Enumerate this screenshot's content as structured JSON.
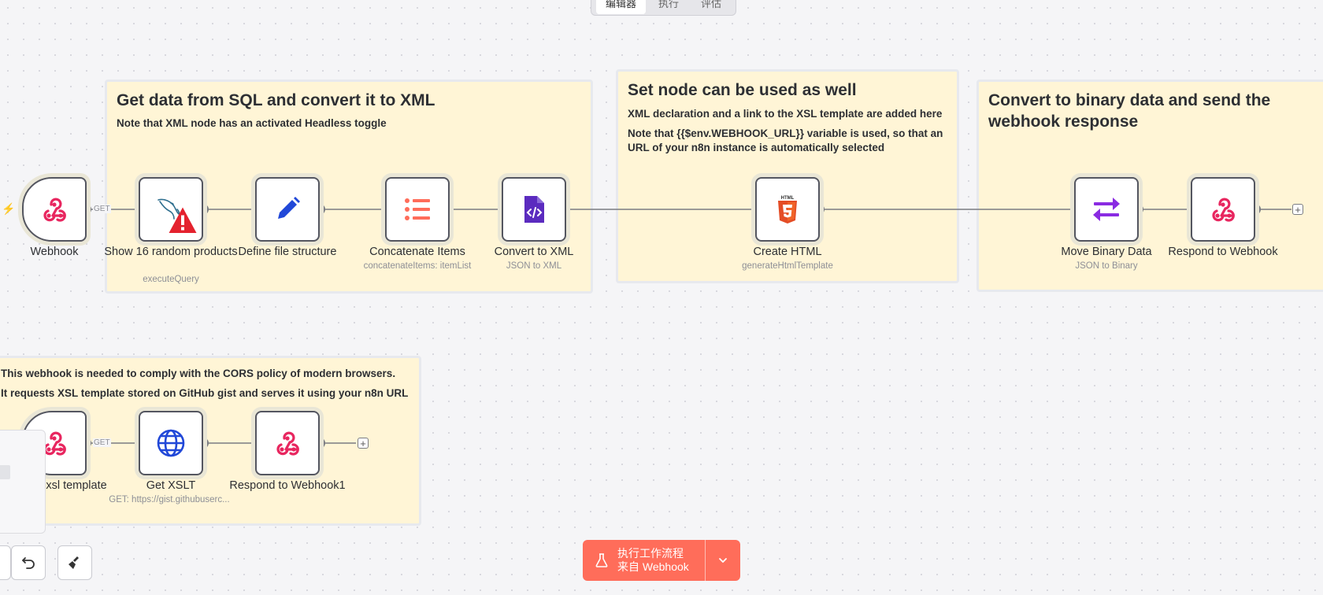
{
  "tabs": [
    {
      "label": "编辑器",
      "active": true
    },
    {
      "label": "执行",
      "active": false
    },
    {
      "label": "评估",
      "active": false
    }
  ],
  "stickies": {
    "sql": {
      "title": "Get data from SQL and convert it to XML",
      "lines": [
        "Note that XML node has an activated Headless toggle"
      ]
    },
    "set": {
      "title": "Set node can be used as well",
      "lines": [
        "XML declaration and a link to the XSL template are added here",
        "Note that {{$env.WEBHOOK_URL}} variable is used, so that an URL of your n8n instance is automatically selected"
      ]
    },
    "binary": {
      "title": "Convert to binary data and send the webhook response",
      "lines": []
    },
    "cors": {
      "title": "",
      "lines": [
        "This webhook is needed to comply with the CORS policy of modern browsers.",
        "It requests XSL template stored on GitHub gist and serves it using your n8n URL"
      ]
    }
  },
  "nodes": {
    "webhook": {
      "label": "Webhook",
      "subtitle": "",
      "icon": "webhook-icon"
    },
    "sql": {
      "label": "Show 16 random products",
      "subtitle": "executeQuery",
      "icon": "mysql-dolphin-icon",
      "has_warning": true
    },
    "define": {
      "label": "Define file structure",
      "subtitle": "",
      "icon": "pencil-icon"
    },
    "concat": {
      "label": "Concatenate Items",
      "subtitle": "concatenateItems: itemList",
      "icon": "list-icon"
    },
    "xml": {
      "label": "Convert to XML",
      "subtitle": "JSON to XML",
      "icon": "code-file-icon"
    },
    "html": {
      "label": "Create HTML",
      "subtitle": "generateHtmlTemplate",
      "icon": "html5-icon"
    },
    "move": {
      "label": "Move Binary Data",
      "subtitle": "JSON to Binary",
      "icon": "arrows-exchange-icon"
    },
    "respond": {
      "label": "Respond to Webhook",
      "subtitle": "",
      "icon": "webhook-icon"
    },
    "xsl": {
      "label": "xsl template",
      "subtitle": "",
      "icon": "webhook-icon"
    },
    "getxslt": {
      "label": "Get XSLT",
      "subtitle": "GET: https://gist.githubuserc...",
      "icon": "globe-icon"
    },
    "respond1": {
      "label": "Respond to Webhook1",
      "subtitle": "",
      "icon": "webhook-icon"
    }
  },
  "edge_labels": {
    "get": "GET"
  },
  "run_button": {
    "line1": "执行工作流程",
    "line2": "来自 Webhook"
  },
  "colors": {
    "accent": "#ff6d5a",
    "sticky_bg": "#fff5d6",
    "webhook": "#e8265f",
    "pencil": "#2148d8",
    "list": "#ff6d5a",
    "xml": "#5b2bbf",
    "html5": "#e44d26",
    "move": "#8a2be2",
    "globe": "#2148d8"
  }
}
